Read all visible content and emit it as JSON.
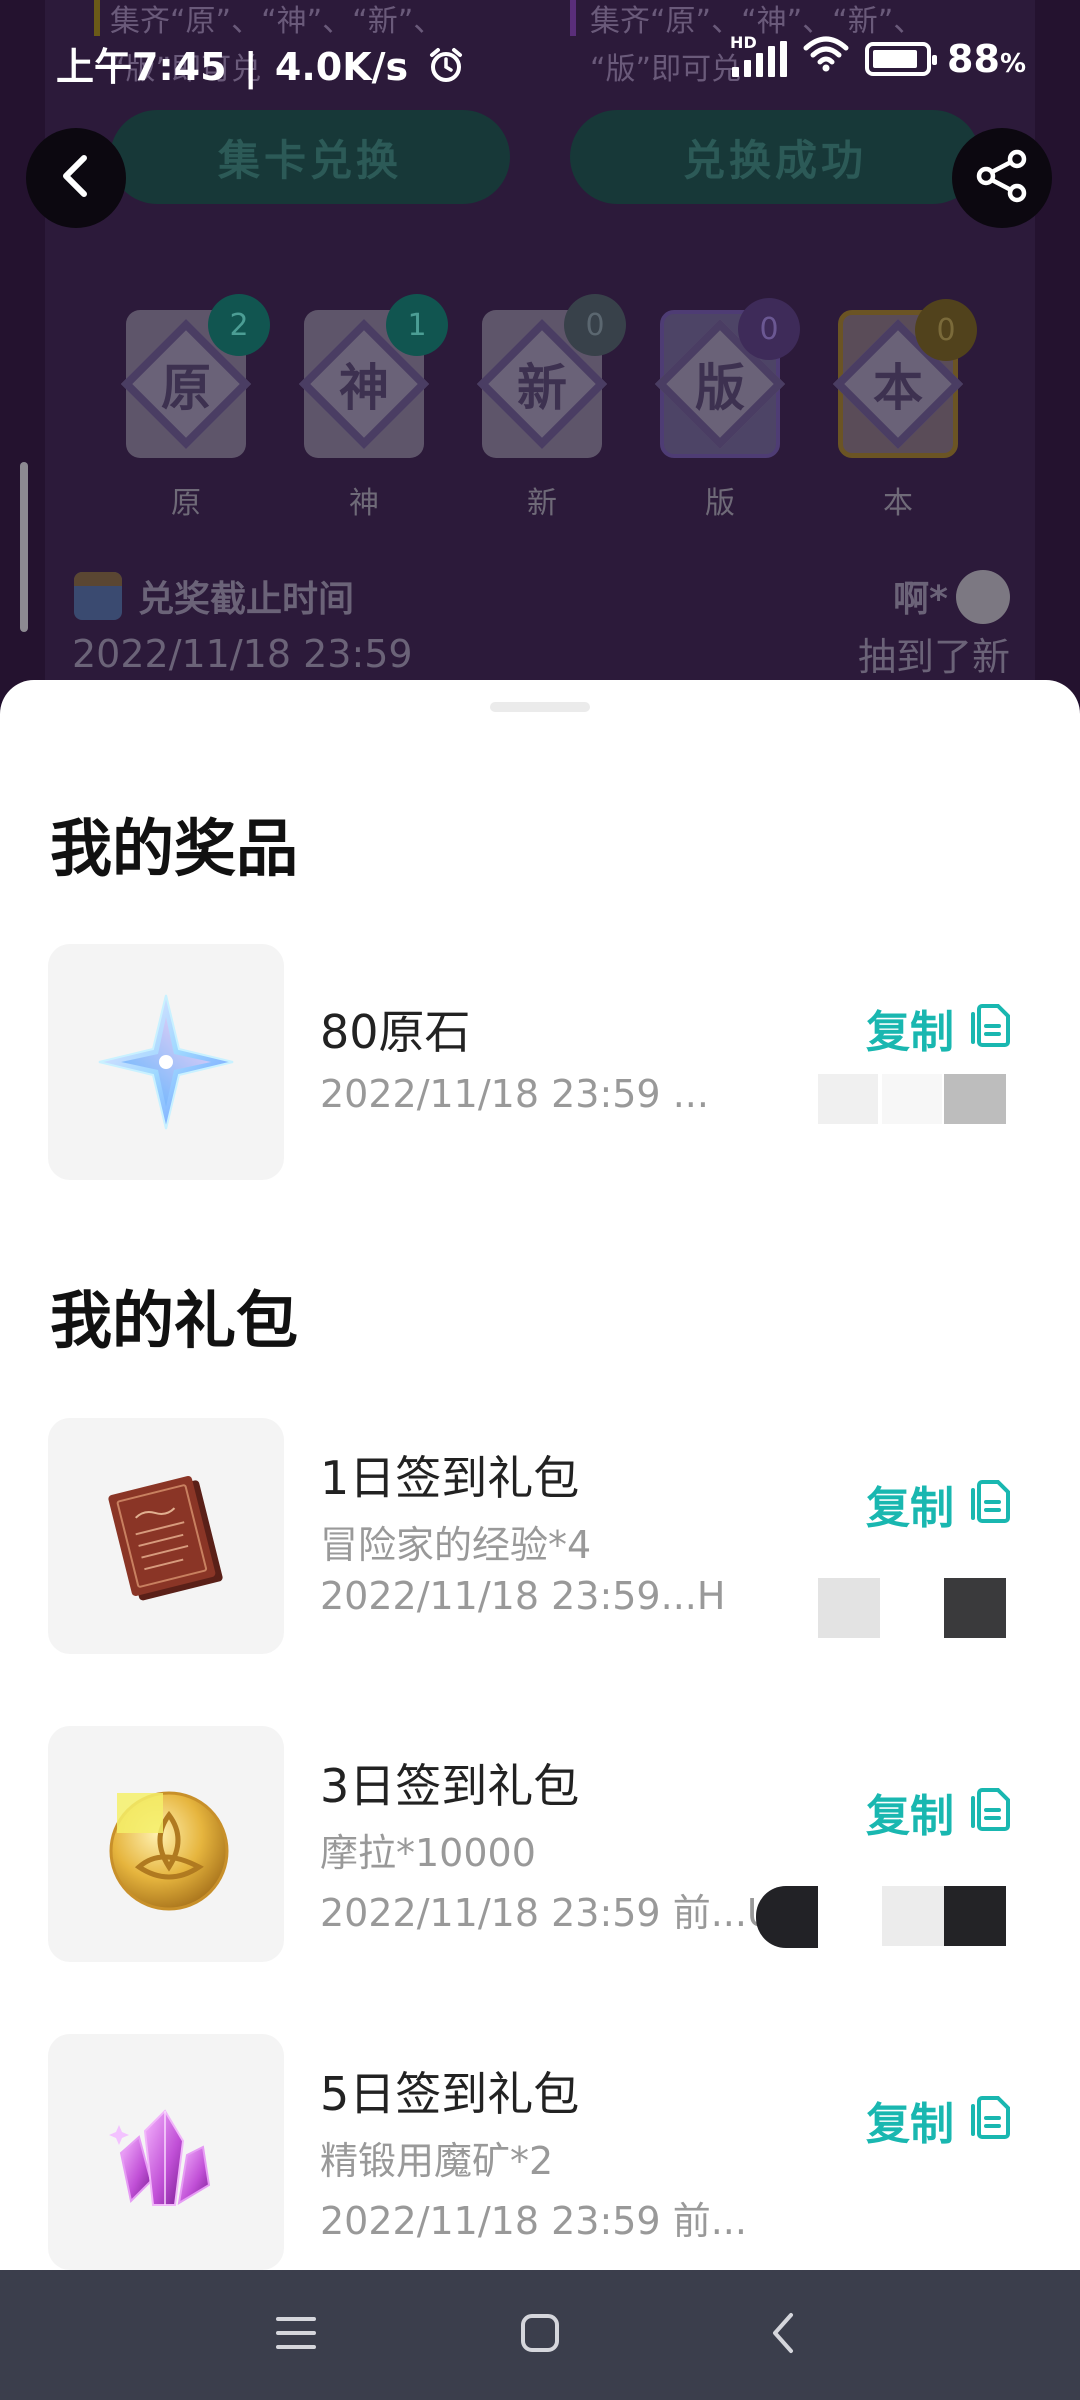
{
  "status_bar": {
    "time": "上午7:45",
    "net_speed": "4.0K/s",
    "network_label": "HD",
    "battery_pct": "88",
    "battery_sign": "%",
    "battery_level": 0.88
  },
  "background": {
    "rule_left": "集齐“原”、“神”、“新”、",
    "rule_left_2": "“版”即可兑",
    "rule_right": "集齐“原”、“神”、“新”、",
    "rule_right_2": "“版”即可兑",
    "btn_exchange": "集卡兑换",
    "btn_success": "兑换成功",
    "cards": [
      {
        "char": "原",
        "count": "2",
        "label": "原"
      },
      {
        "char": "神",
        "count": "1",
        "label": "神"
      },
      {
        "char": "新",
        "count": "0",
        "label": "新"
      },
      {
        "char": "版",
        "count": "0",
        "label": "版"
      },
      {
        "char": "本",
        "count": "0",
        "label": "本"
      }
    ],
    "deadline_label": "兑奖截止时间",
    "deadline_date": "2022/11/18 23:59",
    "feed_name": "啊*",
    "feed_text": "抽到了新"
  },
  "sheet": {
    "prizes_title": "我的奖品",
    "gifts_title": "我的礼包",
    "copy_label": "复制",
    "prizes": [
      {
        "name": "80原石",
        "date": "2022/11/18 23:59 ..."
      }
    ],
    "gifts": [
      {
        "name": "1日签到礼包",
        "desc": "冒险家的经验*4",
        "date": "2022/11/18 23:59...H"
      },
      {
        "name": "3日签到礼包",
        "desc": "摩拉*10000",
        "date": "2022/11/18 23:59 前...U"
      },
      {
        "name": "5日签到礼包",
        "desc": "精锻用魔矿*2",
        "date": "2022/11/18 23:59 前..."
      }
    ]
  },
  "icons": {
    "back": "chevron-left-icon",
    "share": "share-icon",
    "copy": "copy-icon",
    "alarm": "alarm-icon",
    "wifi": "wifi-icon",
    "signal": "signal-icon",
    "battery": "battery-icon",
    "nav_menu": "menu-icon",
    "nav_home": "home-square-icon",
    "nav_back": "back-chevron-icon"
  },
  "colors": {
    "accent": "#19b7b0",
    "sheet_bg": "#ffffff",
    "navbar_bg": "#3b3e4c"
  }
}
